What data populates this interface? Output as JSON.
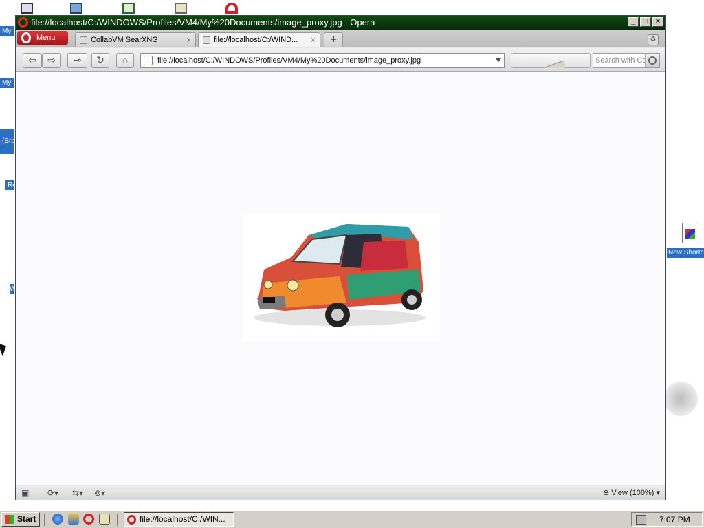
{
  "desktop": {
    "left_labels": [
      "My",
      "My I",
      "(Bro",
      "Re",
      "W"
    ],
    "shortcut_label": "New Shortc"
  },
  "window": {
    "title": "file://localhost/C:/WINDOWS/Profiles/VM4/My%20Documents/image_proxy.jpg - Opera",
    "controls": {
      "minimize": "_",
      "maximize": "□",
      "close": "×"
    }
  },
  "tabbar": {
    "menu_label": "Menu",
    "tabs": [
      {
        "label": "CollabVM SearXNG",
        "active": false
      },
      {
        "label": "file://localhost/C:/WIND...",
        "active": true
      }
    ],
    "new_tab": "+",
    "close_glyph": "×"
  },
  "toolbar": {
    "back_icon": "arrow-left-icon",
    "forward_icon": "arrow-right-icon",
    "key_icon": "key-icon",
    "reload_icon": "reload-icon",
    "home_icon": "home-icon",
    "address_url": "file://localhost/C:/WINDOWS/Profiles/VM4/My%20Documents/image_proxy.jpg",
    "search_placeholder": "Search with Co"
  },
  "statusbar": {
    "zoom_label": "View (100%)"
  },
  "taskbar": {
    "start_label": "Start",
    "task_label": "file://localhost/C:/WIN...",
    "clock": "7:07 PM"
  },
  "colors": {
    "title_green": "#0f4b12",
    "menu_red": "#c8242a",
    "selection_blue": "#2a6fc4"
  }
}
